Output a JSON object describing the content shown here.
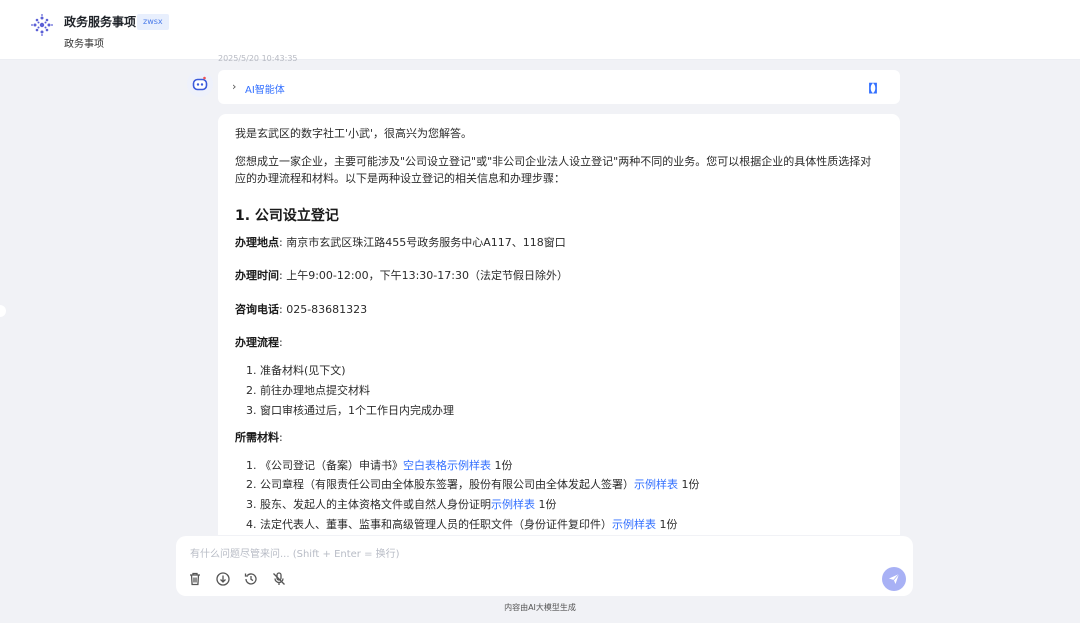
{
  "header": {
    "app_title": "政务服务事项",
    "tag": "zwsx",
    "subtitle": "政务事项"
  },
  "time_fragment": "2025/5/20 10:43:35",
  "agent": {
    "label": "AI智能体",
    "bracket": "【】"
  },
  "answer": {
    "intro": "我是玄武区的数字社工'小武'，很高兴为您解答。",
    "para_line1": "您想成立一家企业，主要可能涉及\"公司设立登记\"或\"非公司企业法人设立登记\"两种不同的业务。您可以根据企业的具体性质选择对",
    "para_line2": "应的办理流程和材料。以下是两种设立登记的相关信息和办理步骤：",
    "heading": "1. 公司设立登记",
    "location_label": "办理地点",
    "location_value": ": 南京市玄武区珠江路455号政务服务中心A117、118窗口",
    "time_label": "办理时间",
    "time_value": ": 上午9:00-12:00，下午13:30-17:30（法定节假日除外）",
    "phone_label": "咨询电话",
    "phone_value": ": 025-83681323",
    "process_label": "办理流程",
    "process_colon": ":",
    "process": [
      "1. 准备材料(见下文)",
      "2. 前往办理地点提交材料",
      "3. 窗口审核通过后，1个工作日内完成办理"
    ],
    "materials_label": "所需材料",
    "materials_colon": ":",
    "materials": [
      {
        "pre": "1. 《公司登记（备案）申请书》",
        "link": "空白表格示例样表",
        "post": " 1份"
      },
      {
        "pre": "2. 公司章程（有限责任公司由全体股东签署，股份有限公司由全体发起人签署）",
        "link": "示例样表",
        "post": " 1份"
      },
      {
        "pre": "3. 股东、发起人的主体资格文件或自然人身份证明",
        "link": "示例样表",
        "post": " 1份"
      },
      {
        "pre": "4. 法定代表人、董事、监事和高级管理人员的任职文件（身份证件复印件）",
        "link": "示例样表",
        "post": " 1份"
      }
    ]
  },
  "input": {
    "placeholder": "有什么问题尽管来问... (Shift + Enter = 换行)"
  },
  "tools": [
    "trash-icon",
    "download-icon",
    "history-icon",
    "mic-off-icon",
    "send-icon"
  ],
  "footer": "内容由AI大模型生成",
  "colors": {
    "accent": "#3370ff",
    "send_button": "#a8b1f5",
    "background": "#f1f2f6"
  }
}
